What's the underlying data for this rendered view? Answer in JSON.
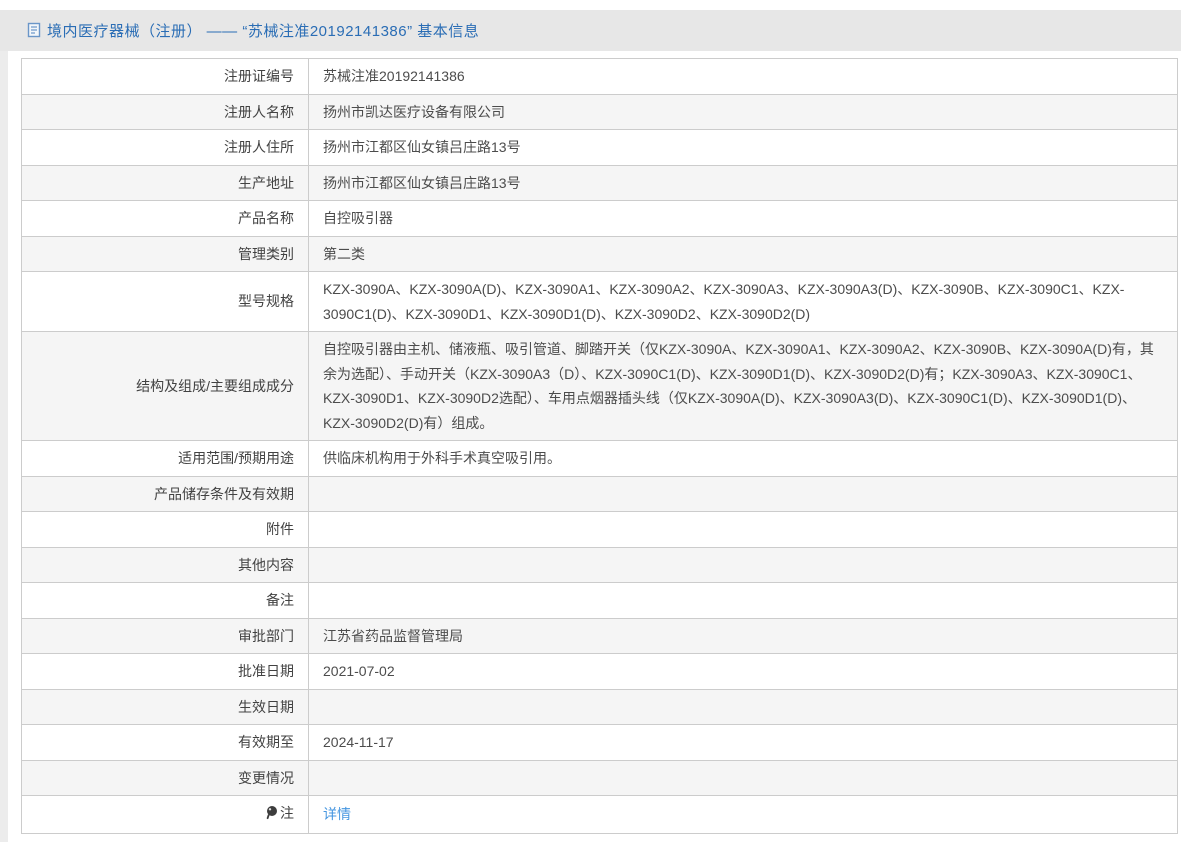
{
  "colors": {
    "page_background": "#ececec",
    "title_bar_background": "#e7e7e7",
    "panel_background": "#ffffff",
    "table_border": "#cccccc",
    "striped_row_background": "#f5f5f5",
    "title_text": "#2a6db5",
    "body_text": "#4c4c4c",
    "link_text": "#4596e0"
  },
  "header": {
    "icon": "document-icon",
    "title": "境内医疗器械（注册） —— “苏械注准20192141386” 基本信息"
  },
  "table": {
    "rows": [
      {
        "label": "注册证编号",
        "value": "苏械注准20192141386"
      },
      {
        "label": "注册人名称",
        "value": "扬州市凯达医疗设备有限公司"
      },
      {
        "label": "注册人住所",
        "value": "扬州市江都区仙女镇吕庄路13号"
      },
      {
        "label": "生产地址",
        "value": "扬州市江都区仙女镇吕庄路13号"
      },
      {
        "label": "产品名称",
        "value": "自控吸引器"
      },
      {
        "label": "管理类别",
        "value": "第二类"
      },
      {
        "label": "型号规格",
        "value": "KZX-3090A、KZX-3090A(D)、KZX-3090A1、KZX-3090A2、KZX-3090A3、KZX-3090A3(D)、KZX-3090B、KZX-3090C1、KZX-3090C1(D)、KZX-3090D1、KZX-3090D1(D)、KZX-3090D2、KZX-3090D2(D)"
      },
      {
        "label": "结构及组成/主要组成成分",
        "value": "自控吸引器由主机、储液瓶、吸引管道、脚踏开关（仅KZX-3090A、KZX-3090A1、KZX-3090A2、KZX-3090B、KZX-3090A(D)有，其余为选配）、手动开关（KZX-3090A3（D）、KZX-3090C1(D)、KZX-3090D1(D)、KZX-3090D2(D)有；KZX-3090A3、KZX-3090C1、KZX-3090D1、KZX-3090D2选配）、车用点烟器插头线（仅KZX-3090A(D)、KZX-3090A3(D)、KZX-3090C1(D)、KZX-3090D1(D)、KZX-3090D2(D)有）组成。"
      },
      {
        "label": "适用范围/预期用途",
        "value": "供临床机构用于外科手术真空吸引用。"
      },
      {
        "label": "产品储存条件及有效期",
        "value": ""
      },
      {
        "label": "附件",
        "value": ""
      },
      {
        "label": "其他内容",
        "value": ""
      },
      {
        "label": "备注",
        "value": ""
      },
      {
        "label": "审批部门",
        "value": "江苏省药品监督管理局"
      },
      {
        "label": "批准日期",
        "value": "2021-07-02"
      },
      {
        "label": "生效日期",
        "value": ""
      },
      {
        "label": "有效期至",
        "value": "2024-11-17"
      },
      {
        "label": "变更情况",
        "value": ""
      },
      {
        "label": "注",
        "value": "详情",
        "label_icon": "note-bulb-icon",
        "value_is_link": true
      }
    ]
  }
}
